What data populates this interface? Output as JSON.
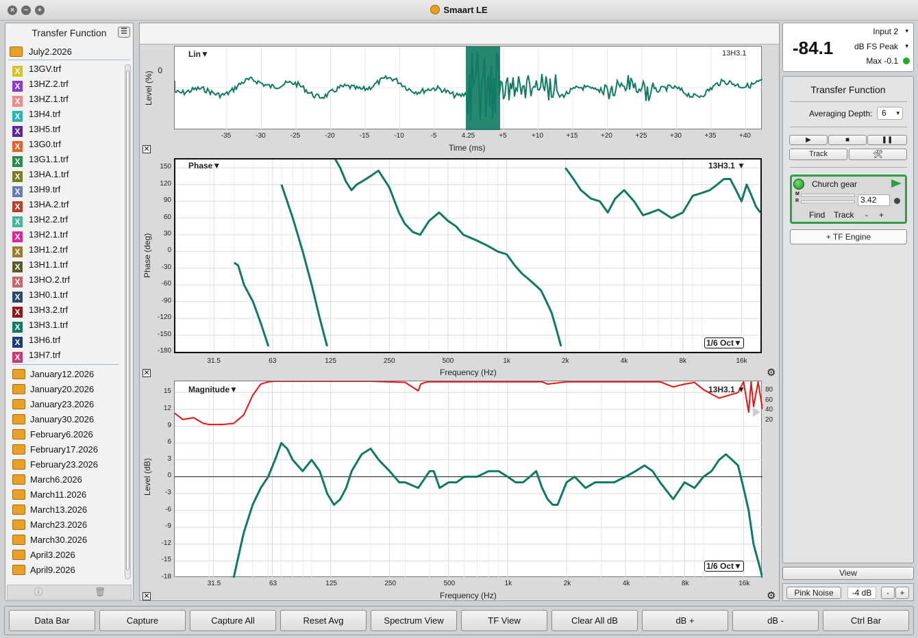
{
  "app": {
    "title": "Smaart LE"
  },
  "sidebar": {
    "title": "Transfer Function",
    "open_folder": "July2.2026",
    "files": [
      {
        "name": "13GV.trf",
        "color": "#d4c42a"
      },
      {
        "name": "13HZ.2.trf",
        "color": "#8a3cc4"
      },
      {
        "name": "13HZ.1.trf",
        "color": "#f08a8a"
      },
      {
        "name": "13H4.trf",
        "color": "#2ab3b3"
      },
      {
        "name": "13H5.trf",
        "color": "#5a2a9a"
      },
      {
        "name": "13G0.trf",
        "color": "#e0632a"
      },
      {
        "name": "13G1.1.trf",
        "color": "#2a8a4a"
      },
      {
        "name": "13HA.1.trf",
        "color": "#7a7a22"
      },
      {
        "name": "13H9.trf",
        "color": "#6a7ab4"
      },
      {
        "name": "13HA.2.trf",
        "color": "#b4402a"
      },
      {
        "name": "13H2.2.trf",
        "color": "#4ab49a"
      },
      {
        "name": "13H2.1.trf",
        "color": "#d42a9a"
      },
      {
        "name": "13H1.2.trf",
        "color": "#9a7a2a"
      },
      {
        "name": "13H1.1.trf",
        "color": "#5a5a2a"
      },
      {
        "name": "13HO.2.trf",
        "color": "#c46a6a"
      },
      {
        "name": "13H0.1.trf",
        "color": "#2a4a6a"
      },
      {
        "name": "13H3.2.trf",
        "color": "#8a1a1a"
      },
      {
        "name": "13H3.1.trf",
        "color": "#0f7a62"
      },
      {
        "name": "13H6.trf",
        "color": "#1a3a7a"
      },
      {
        "name": "13H7.trf",
        "color": "#c43a7a"
      }
    ],
    "folders": [
      "January12.2026",
      "January20.2026",
      "January23.2026",
      "January30.2026",
      "February6.2026",
      "February17.2026",
      "February23.2026",
      "March6.2026",
      "March11.2026",
      "March13.2026",
      "March23.2026",
      "March30.2026",
      "April3.2026",
      "April9.2026"
    ],
    "footer_icons": [
      "info-icon",
      "trash-icon"
    ]
  },
  "ir_plot": {
    "mode_label": "Lin▼",
    "trace_label": "13H3.1",
    "ylabel": "Level (%)",
    "xlabel": "Time (ms)",
    "y_tick": "0",
    "x_ticks": [
      "-35",
      "-30",
      "-25",
      "-20",
      "-15",
      "-10",
      "-5",
      "4.25",
      "+5",
      "+10",
      "+15",
      "+20",
      "+25",
      "+30",
      "+35",
      "+40"
    ]
  },
  "phase_plot": {
    "mode_label": "Phase▼",
    "trace_label": "13H3.1 ▼",
    "smoothing": "1/6 Oct▼",
    "ylabel": "Phase (deg)",
    "xlabel": "Frequency (Hz)",
    "y_ticks": [
      "150",
      "120",
      "90",
      "60",
      "30",
      "0",
      "-30",
      "-60",
      "-90",
      "-120",
      "-150",
      "-180"
    ],
    "x_ticks": [
      "31.5",
      "63",
      "125",
      "250",
      "500",
      "1k",
      "2k",
      "4k",
      "8k",
      "16k"
    ]
  },
  "mag_plot": {
    "mode_label": "Magnitude▼",
    "trace_label": "13H3.1 ▼",
    "smoothing": "1/6 Oct▼",
    "ylabel": "Level (dB)",
    "xlabel": "Frequency (Hz)",
    "y_ticks": [
      "15",
      "12",
      "9",
      "6",
      "3",
      "0",
      "-3",
      "-6",
      "-9",
      "-12",
      "-15",
      "-18"
    ],
    "coh_ticks": [
      "80",
      "60",
      "40",
      "20"
    ],
    "x_ticks": [
      "31.5",
      "63",
      "125",
      "250",
      "500",
      "1k",
      "2k",
      "4k",
      "8k",
      "16k"
    ]
  },
  "chart_data": [
    {
      "type": "line",
      "xlabel": "Frequency (Hz)",
      "ylabel": "Phase (deg)",
      "x_scale": "log",
      "ylim": [
        -180,
        180
      ],
      "series": [
        {
          "name": "13H3.1",
          "color": "#0f7a62",
          "x": [
            40,
            42,
            45,
            50,
            55,
            60,
            70,
            80,
            90,
            100,
            110,
            120,
            130,
            140,
            150,
            160,
            170,
            180,
            200,
            220,
            250,
            280,
            300,
            330,
            360,
            400,
            450,
            500,
            550,
            600,
            700,
            800,
            900,
            1000,
            1100,
            1200,
            1300,
            1400,
            1500,
            1600,
            1700,
            1800,
            1900,
            2000,
            2100,
            2200,
            2300,
            2400,
            2500,
            2700,
            3000,
            3300,
            3600,
            4000,
            4500,
            5000,
            5500,
            6000,
            7000,
            8000,
            9000,
            10000,
            11000,
            12000,
            13000,
            14000,
            15000,
            16000,
            17000,
            18000,
            19000,
            20000
          ],
          "y": [
            -20,
            -25,
            -60,
            -90,
            -130,
            -170,
            120,
            60,
            0,
            -60,
            -120,
            -170,
            170,
            150,
            125,
            110,
            120,
            125,
            135,
            145,
            115,
            70,
            50,
            35,
            30,
            55,
            70,
            55,
            45,
            30,
            20,
            10,
            0,
            -5,
            -25,
            -40,
            -50,
            -60,
            -70,
            -90,
            -110,
            -140,
            -170,
            150,
            140,
            130,
            120,
            110,
            105,
            95,
            90,
            70,
            95,
            110,
            90,
            65,
            70,
            75,
            60,
            70,
            100,
            105,
            110,
            120,
            130,
            130,
            110,
            90,
            120,
            100,
            80,
            70
          ]
        }
      ]
    },
    {
      "type": "line",
      "xlabel": "Frequency (Hz)",
      "ylabel": "Level (dB)",
      "x_scale": "log",
      "ylim": [
        -18,
        17
      ],
      "series": [
        {
          "name": "13H3.1",
          "color": "#0f7a62",
          "x": [
            40,
            45,
            50,
            55,
            60,
            65,
            70,
            75,
            80,
            90,
            100,
            110,
            120,
            130,
            140,
            150,
            160,
            180,
            200,
            220,
            250,
            280,
            300,
            350,
            400,
            420,
            450,
            500,
            550,
            600,
            700,
            800,
            900,
            1000,
            1100,
            1200,
            1300,
            1400,
            1500,
            1600,
            1700,
            1800,
            2000,
            2200,
            2500,
            2800,
            3000,
            3500,
            4000,
            4500,
            5000,
            5500,
            6000,
            7000,
            8000,
            9000,
            10000,
            11000,
            12000,
            13000,
            14000,
            15000,
            16000,
            17000,
            18000,
            19000,
            20000
          ],
          "y": [
            -18,
            -10,
            -5,
            -2,
            0,
            3,
            6,
            5,
            3,
            1,
            3,
            1,
            -3,
            -5,
            -4,
            -2,
            1,
            4,
            5,
            3,
            1,
            -1,
            -1,
            -2,
            1,
            1,
            -2,
            -1,
            -1,
            0,
            0,
            1,
            1,
            0,
            -1,
            -1,
            0,
            1,
            -2,
            -4,
            -5,
            -5,
            -1,
            0,
            -2,
            -1,
            -1,
            -1,
            0,
            1,
            2,
            1,
            -1,
            -4,
            -1,
            -2,
            0,
            1,
            3,
            4,
            3,
            2,
            -2,
            -6,
            -12,
            -15,
            -18
          ]
        },
        {
          "name": "Coherence",
          "color": "#ee1111",
          "x": [
            20,
            22,
            25,
            28,
            30,
            35,
            40,
            45,
            50,
            55,
            60,
            65,
            70,
            80,
            100,
            150,
            200,
            300,
            350,
            360,
            380,
            400,
            500,
            800,
            1000,
            1500,
            1600,
            2000,
            3000,
            6000,
            7000,
            8000,
            9000,
            10000,
            12000,
            15000,
            16000,
            17000,
            17500,
            18000,
            19000,
            20000
          ],
          "y": [
            11.3,
            10.2,
            10.5,
            9.5,
            9.3,
            9.3,
            9.5,
            11,
            14.5,
            16.5,
            16.9,
            17,
            17,
            17,
            17,
            17,
            17,
            16.8,
            15.3,
            16.5,
            16.8,
            16.9,
            16.9,
            16.9,
            16.9,
            16.9,
            16.5,
            16.9,
            16.9,
            16.9,
            16.0,
            16.5,
            16.8,
            15.5,
            14.0,
            15,
            16.9,
            11.5,
            16.9,
            12.5,
            16.9,
            12.0
          ]
        }
      ]
    }
  ],
  "meter": {
    "input": "Input 2",
    "value": "-84.1",
    "unit": "dB FS Peak",
    "max": "Max -0.1",
    "status_color": "#22aa22"
  },
  "right_panel": {
    "title": "Transfer Function",
    "averaging_label": "Averaging Depth:",
    "averaging_value": "6",
    "track_label": "Track",
    "engine": {
      "name": "Church gear",
      "delay": "3.42",
      "find": "Find",
      "track": "Track",
      "minus": "-",
      "plus": "+",
      "m": "M",
      "r": "R"
    },
    "add_engine": "+ TF Engine",
    "view_label": "View",
    "pink_noise": "Pink Noise",
    "pink_level": "-4 dB",
    "minus": "-",
    "plus": "+"
  },
  "bottom_buttons": [
    "Data Bar",
    "Capture",
    "Capture All",
    "Reset Avg",
    "Spectrum View",
    "TF View",
    "Clear All dB",
    "dB +",
    "dB -",
    "Ctrl Bar"
  ]
}
